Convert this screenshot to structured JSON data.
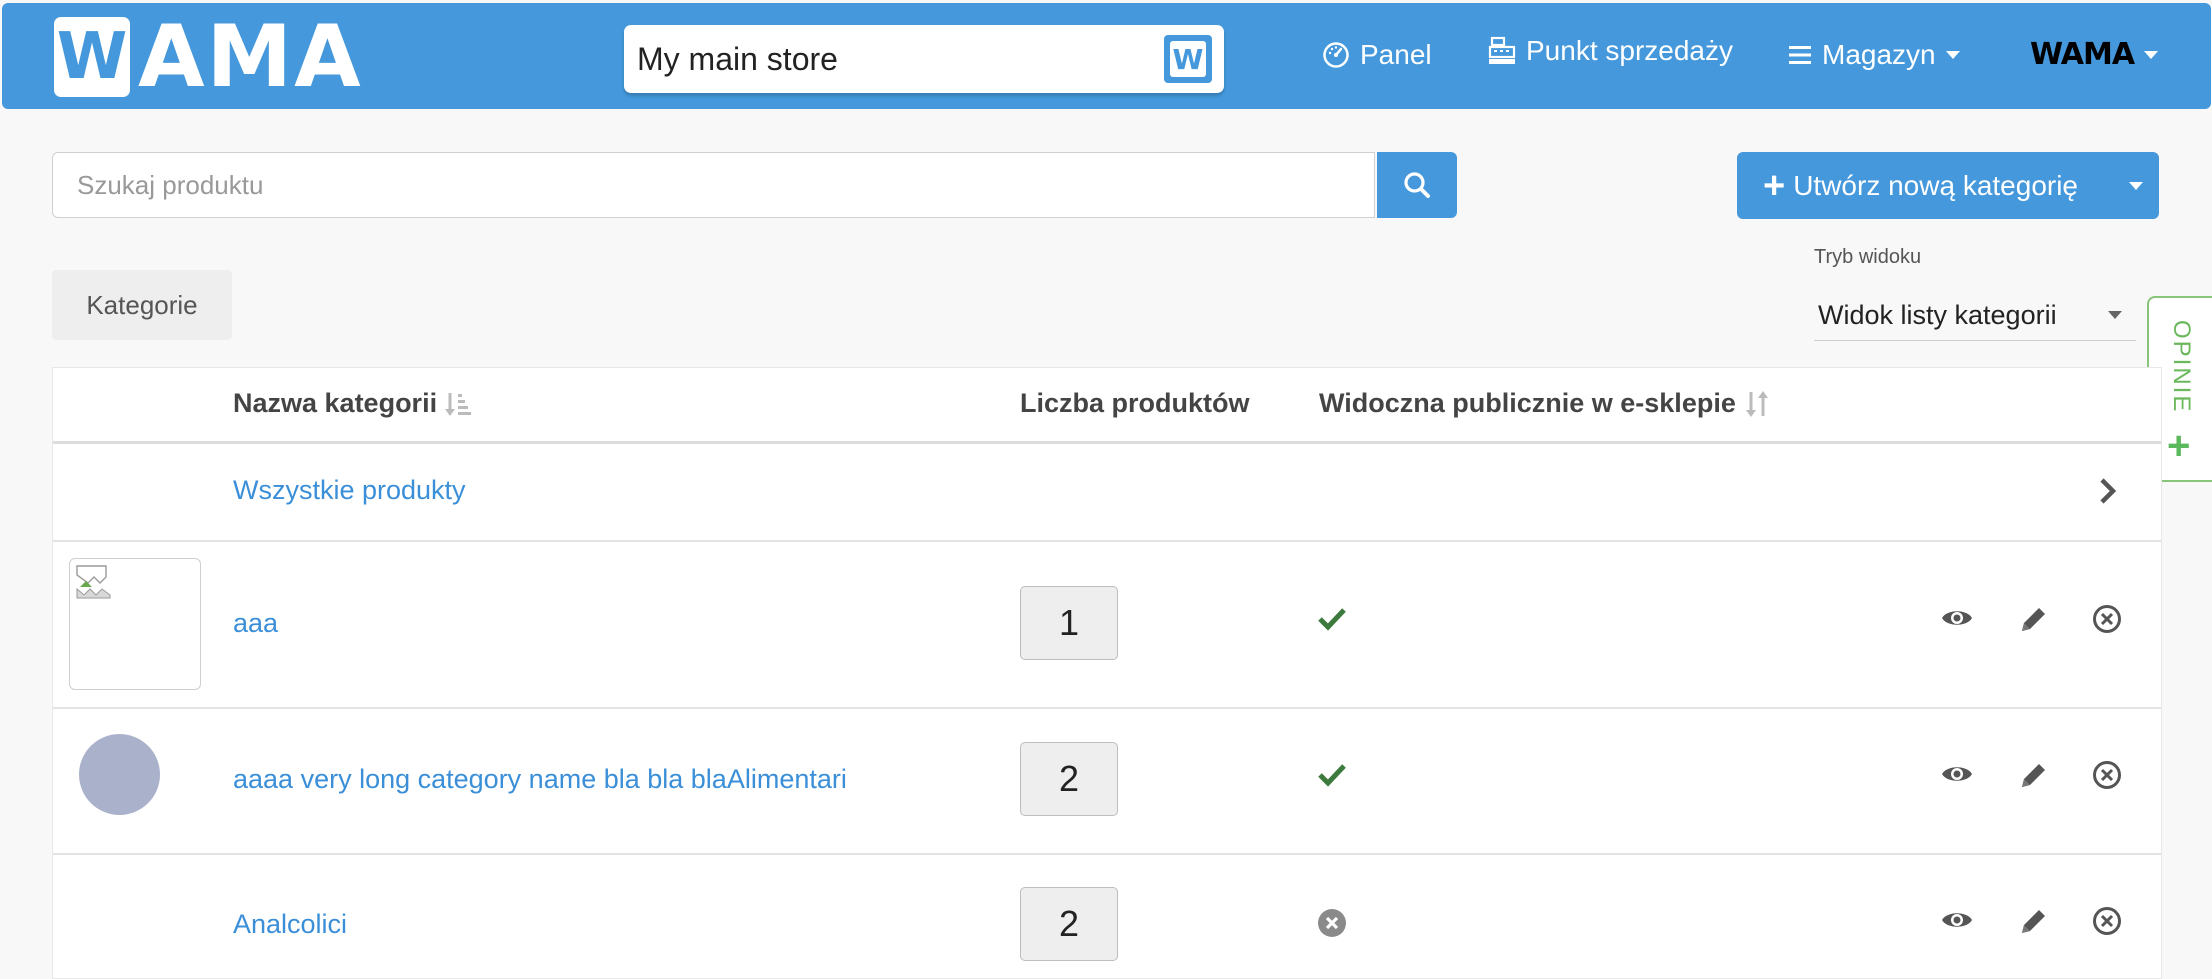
{
  "header": {
    "logo_text": "WAMA",
    "store_name": "My main store",
    "nav": [
      {
        "label": "Panel",
        "icon": "gauge-icon"
      },
      {
        "label": "Punkt sprzedaży",
        "icon": "cash-register-icon"
      },
      {
        "label": "Magazyn",
        "icon": "hamburger-icon"
      }
    ],
    "user_menu_logo": "WAMA"
  },
  "search": {
    "placeholder": "Szukaj produktu"
  },
  "create_button": {
    "label": "Utwórz nową kategorię"
  },
  "breadcrumb": {
    "label": "Kategorie"
  },
  "view_mode": {
    "label": "Tryb widoku",
    "value": "Widok listy kategorii"
  },
  "feedback_tab": {
    "label": "OPINIE"
  },
  "table": {
    "headers": {
      "name": "Nazwa kategorii",
      "count": "Liczba produktów",
      "visible": "Widoczna publicznie w e-sklepie"
    },
    "all_products": "Wszystkie produkty",
    "rows": [
      {
        "name": "aaa",
        "count": "1",
        "visible": true,
        "image": "broken-image"
      },
      {
        "name": "aaaa very long category name bla bla blaAlimentari",
        "count": "2",
        "visible": true,
        "image": "circle-avatar"
      },
      {
        "name": "Analcolici",
        "count": "2",
        "visible": false,
        "image": "none"
      }
    ]
  },
  "colors": {
    "primary": "#4498db",
    "link": "#3a8fd8",
    "check": "#3d7a3d",
    "feedback": "#6ab85b"
  }
}
